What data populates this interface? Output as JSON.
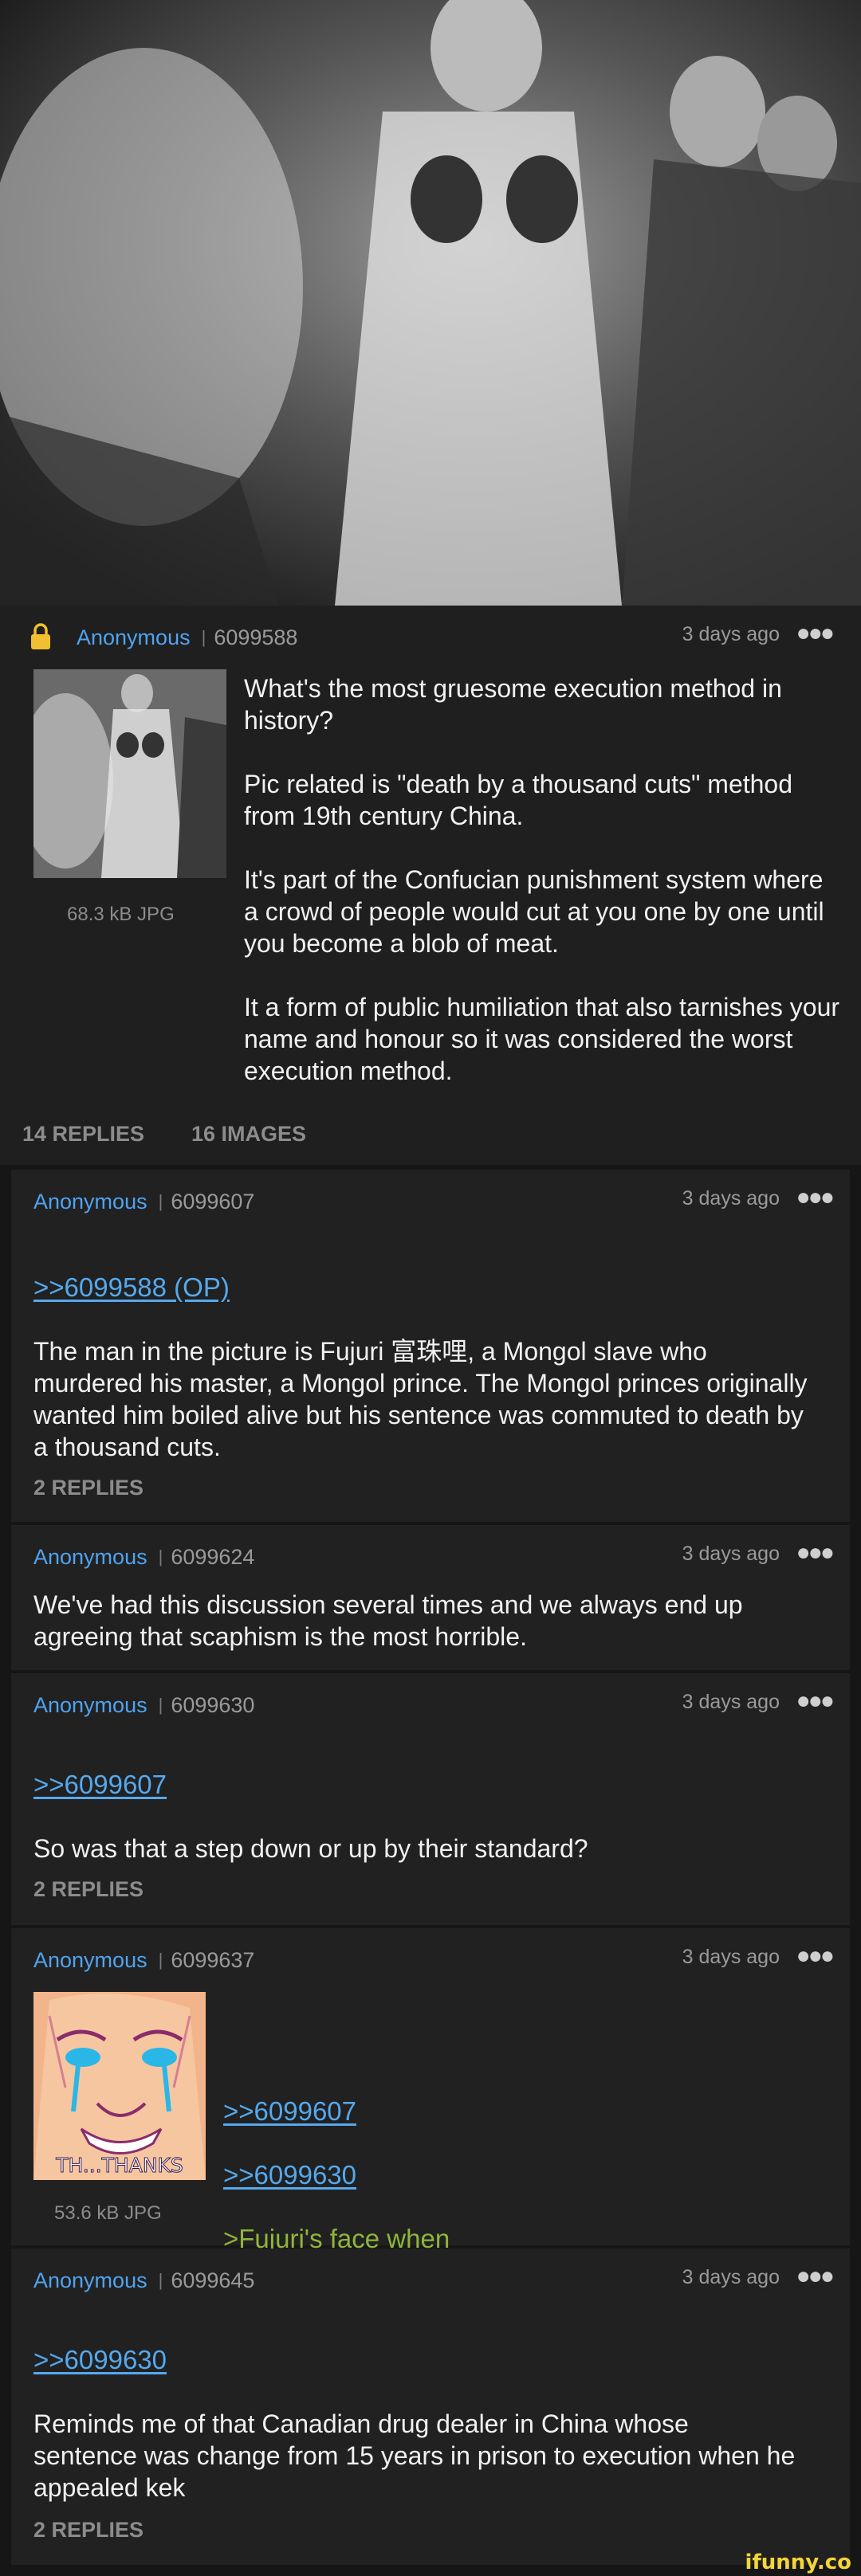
{
  "op": {
    "author": "Anonymous",
    "post_id": "6099588",
    "time_ago": "3 days ago",
    "more_icon": "more-dots-icon",
    "lock_icon": "lock-icon",
    "image_size": "68.3 kB JPG",
    "text": "What's the most gruesome execution method in history?\n\nPic related is \"death by a thousand cuts\" method from 19th century China.\n\nIt's part of the Confucian punishment system where a crowd of people would cut at you one by one until you become a blob of meat.\n\nIt a form of public humiliation that also tarnishes your name and honour so it was considered the worst execution method.",
    "replies_count": "14 REPLIES",
    "images_count": "16 IMAGES"
  },
  "replies": [
    {
      "author": "Anonymous",
      "post_id": "6099607",
      "time_ago": "3 days ago",
      "quote": ">>6099588 (OP)",
      "text": "The man in the picture is Fujuri 富珠哩, a Mongol slave who murdered his master, a Mongol prince. The Mongol princes originally wanted him boiled alive but his sentence was commuted to death by a thousand cuts.",
      "replies_count": "2 REPLIES"
    },
    {
      "author": "Anonymous",
      "post_id": "6099624",
      "time_ago": "3 days ago",
      "text": "We've had this discussion several times and we always end up agreeing that scaphism is the most horrible."
    },
    {
      "author": "Anonymous",
      "post_id": "6099630",
      "time_ago": "3 days ago",
      "quote": ">>6099607",
      "text": "So was that a step down or up by their standard?",
      "replies_count": "2 REPLIES"
    },
    {
      "author": "Anonymous",
      "post_id": "6099637",
      "time_ago": "3 days ago",
      "quote1": ">>6099607",
      "quote2": ">>6099630",
      "greentext": ">Fujuri's face when",
      "image_caption": "TH...THANKS",
      "image_size": "53.6 kB JPG"
    },
    {
      "author": "Anonymous",
      "post_id": "6099645",
      "time_ago": "3 days ago",
      "quote": ">>6099630",
      "text": "Reminds me of that Canadian drug dealer in China whose sentence was change from 15 years in prison to execution when he appealed kek",
      "replies_count": "2 REPLIES"
    }
  ],
  "watermark": "ifunny.co",
  "colors": {
    "name": "#4fa3f0",
    "quote": "#55a9ee",
    "greentext": "#8fb53a"
  }
}
